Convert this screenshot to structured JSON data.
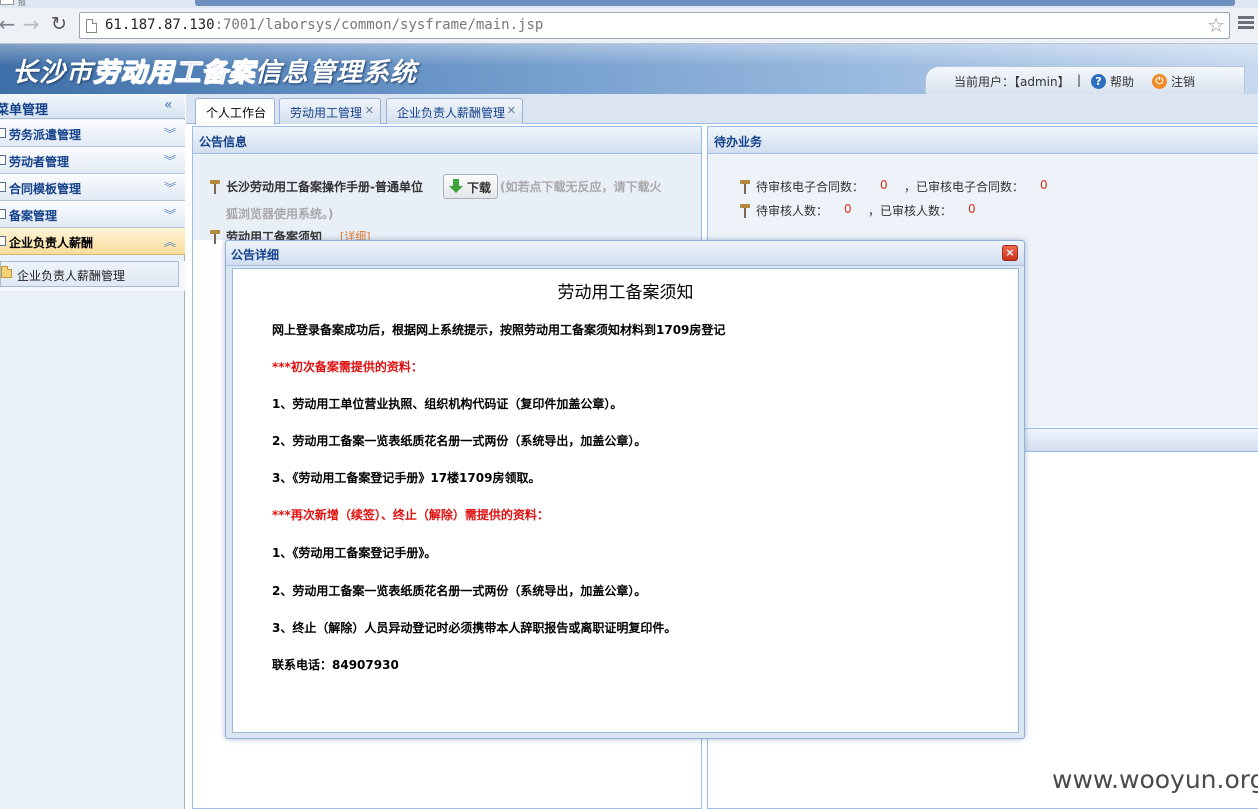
{
  "browser": {
    "tab_fragment": "报",
    "url_host": "61.187.87.130",
    "url_rest": ":7001/laborsys/common/sysframe/main.jsp"
  },
  "header": {
    "title_part1": "长沙市",
    "title_part2": "劳动用工备案",
    "title_part3": "信息管理系统",
    "current_user": "当前用户：【admin】",
    "separator": "|",
    "help": "帮助",
    "logout": "注销"
  },
  "sidebar": {
    "head": "菜单管理",
    "items": [
      {
        "label": "劳务派遣管理"
      },
      {
        "label": "劳动者管理"
      },
      {
        "label": "合同模板管理"
      },
      {
        "label": "备案管理"
      },
      {
        "label": "企业负责人薪酬"
      }
    ],
    "sub_item": "企业负责人薪酬管理"
  },
  "tabs": [
    {
      "label": "个人工作台",
      "closable": false
    },
    {
      "label": "劳动用工管理",
      "closable": true
    },
    {
      "label": "企业负责人薪酬管理",
      "closable": true
    }
  ],
  "announcements": {
    "title": "公告信息",
    "item1": "长沙劳动用工备案操作手册-普通单位",
    "download": "下载",
    "hint_line1": "(如若点下载无反应，请下载火",
    "hint_line2": "狐浏览器使用系统。)",
    "item2": "劳动用工备案须知",
    "detail": "[详细]"
  },
  "todo": {
    "title": "待办业务",
    "row1_label_a": "待审核电子合同数：",
    "row1_val_a": "0",
    "row1_label_b": "，已审核电子合同数：",
    "row1_val_b": "0",
    "row2_label_a": "待审核人数：",
    "row2_val_a": "0",
    "row2_label_b": "，已审核人数：",
    "row2_val_b": "0"
  },
  "modal": {
    "title": "公告详细",
    "close": "×",
    "doc_title": "劳动用工备案须知",
    "lines": [
      "网上登录备案成功后，根据网上系统提示，按照劳动用工备案须知材料到1709房登记",
      "***初次备案需提供的资料：",
      "1、劳动用工单位营业执照、组织机构代码证（复印件加盖公章）。",
      "2、劳动用工备案一览表纸质花名册一式两份（系统导出，加盖公章）。",
      "3、《劳动用工备案登记手册》17楼1709房领取。",
      "***再次新增（续签）、终止（解除）需提供的资料：",
      "1、《劳动用工备案登记手册》。",
      "2、劳动用工备案一览表纸质花名册一式两份（系统导出，加盖公章）。",
      "3、终止（解除）人员异动登记时必须携带本人辞职报告或离职证明复印件。",
      "联系电话：84907930"
    ]
  },
  "watermark": "www.wooyun.org",
  "colors": {
    "accent": "#15428b",
    "alert_red": "#e01010",
    "count_red": "#e0301e"
  }
}
